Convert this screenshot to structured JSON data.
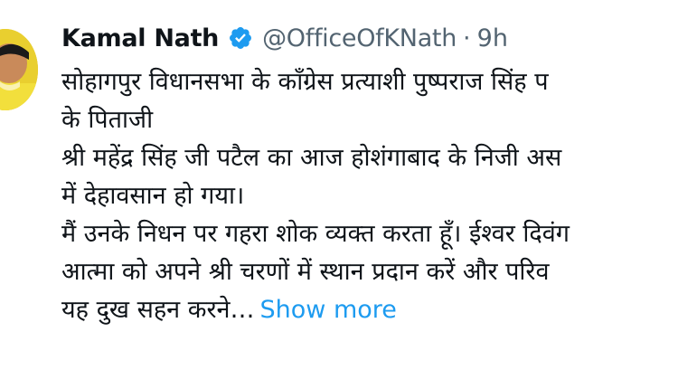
{
  "tweet": {
    "author_name": "Kamal Nath",
    "handle": "@OfficeOfKNath",
    "separator": "·",
    "time": "9h",
    "verified": true,
    "lines": [
      "सोहागपुर विधानसभा के काँग्रेस प्रत्याशी पुष्पराज सिंह प",
      "के पिताजी",
      "श्री महेंद्र सिंह जी पटैल का आज होशंगाबाद के निजी अस",
      "में देहावसान हो गया।",
      "मैं उनके निधन पर गहरा शोक व्यक्त करता हूँ। ईश्वर दिवंग",
      "आत्मा को अपने श्री चरणों में स्थान प्रदान करें और परिव",
      "यह दुख सहन करने…"
    ],
    "show_more": "Show more"
  },
  "icons": {
    "avatar": "profile-photo",
    "verified": "verified-badge-icon"
  },
  "colors": {
    "text": "#0f1419",
    "secondary": "#536471",
    "link": "#1d9bf0",
    "verified": "#1d9bf0",
    "background": "#ffffff"
  }
}
